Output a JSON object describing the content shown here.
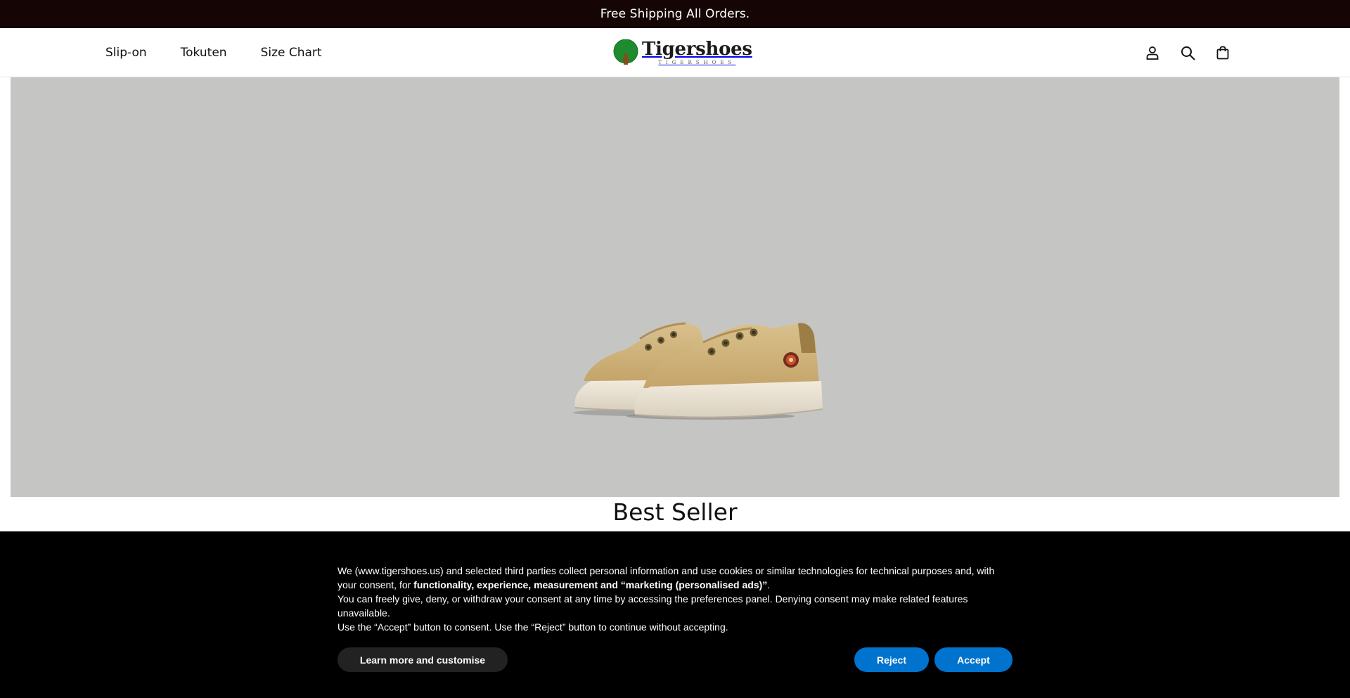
{
  "announcement": {
    "text": "Free Shipping All Orders."
  },
  "header": {
    "nav": [
      {
        "label": "Slip-on"
      },
      {
        "label": "Tokuten"
      },
      {
        "label": "Size Chart"
      }
    ],
    "logo": {
      "name": "Tigershoes",
      "tagline": "TIGERSHOES"
    },
    "icons": [
      "account-icon",
      "search-icon",
      "cart-icon"
    ]
  },
  "hero": {
    "image": "beige-slip-on-sneakers-image"
  },
  "section": {
    "title": "Best Seller"
  },
  "cookie_banner": {
    "line1_a": "We (www.tigershoes.us) and selected third parties collect personal information and use cookies or similar technologies for technical purposes and, with your consent, for ",
    "line1_bold": "functionality, experience, measurement and “marketing (personalised ads)”",
    "line1_end": ".",
    "line2": "You can freely give, deny, or withdraw your consent at any time by accessing the preferences panel. Denying consent may make related features unavailable.",
    "line3": "Use the “Accept” button to consent. Use the “Reject” button to continue without accepting.",
    "learn_more_label": "Learn more and customise",
    "reject_label": "Reject",
    "accept_label": "Accept"
  },
  "colors": {
    "announcement_bg": "#150605",
    "hero_bg": "#c5c5c3",
    "cookie_bg": "#000000",
    "button_blue": "#0073ce",
    "button_dark": "#222222"
  }
}
